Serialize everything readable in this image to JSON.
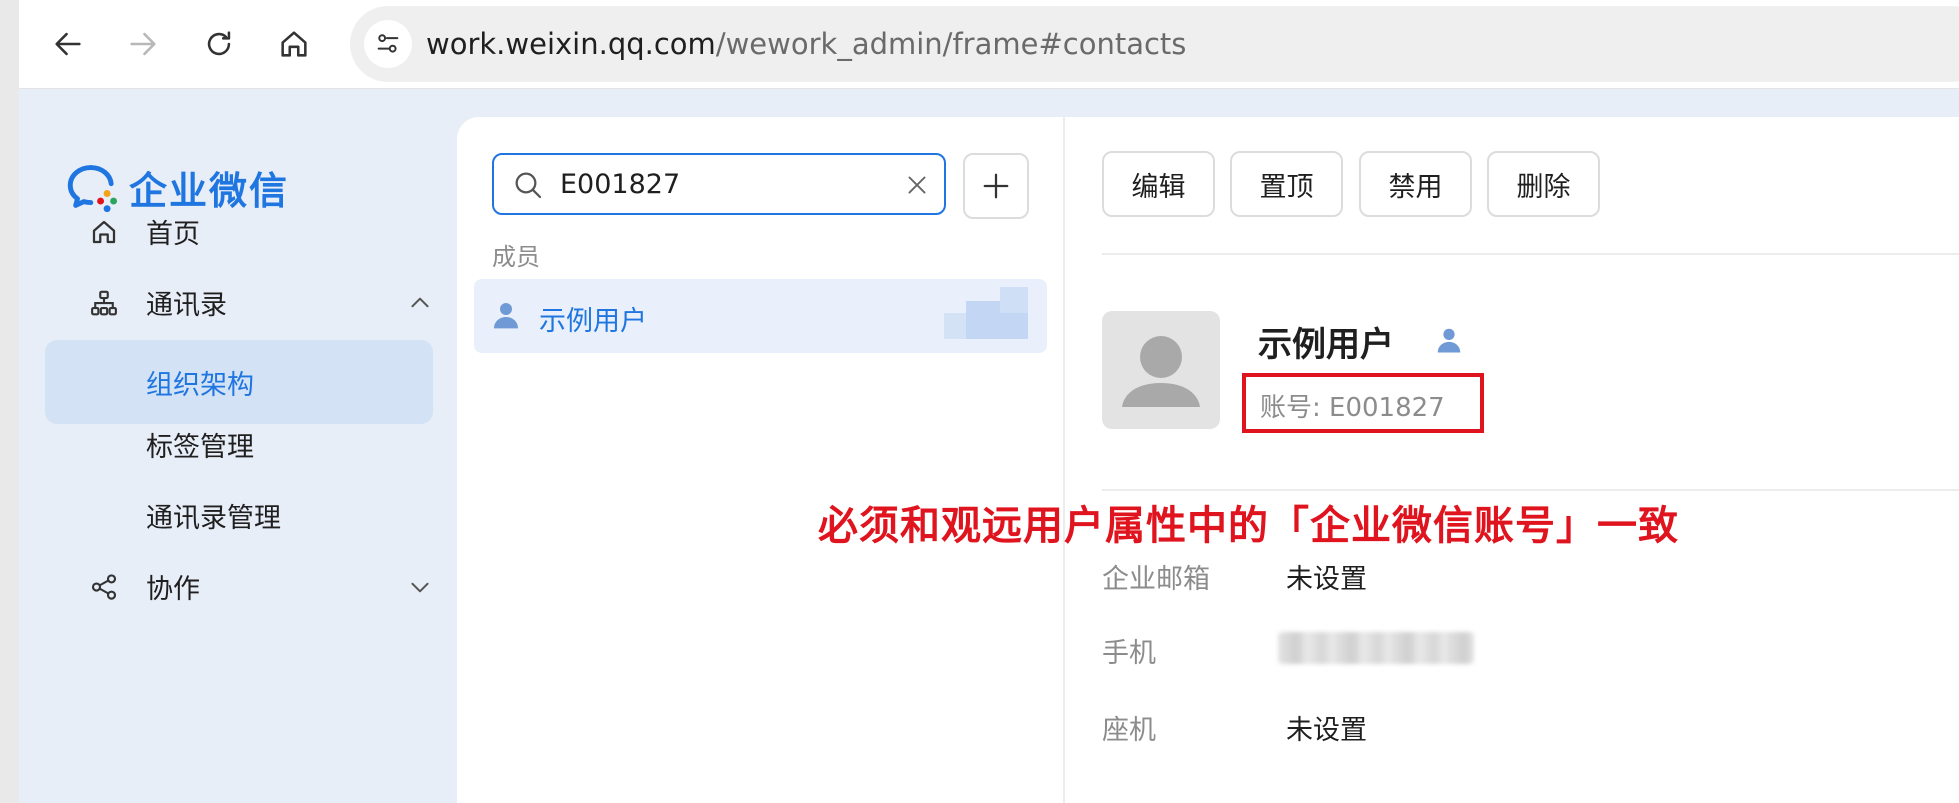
{
  "browser": {
    "url_host": "work.weixin.qq.com",
    "url_path": "/wework_admin/frame#contacts"
  },
  "brand": {
    "name": "企业微信",
    "color": "#1f76e0"
  },
  "sidebar": {
    "items": [
      {
        "label": "首页",
        "icon": "home-icon"
      },
      {
        "label": "通讯录",
        "icon": "org-chart-icon",
        "expanded": true
      },
      {
        "label": "组织架构",
        "active": true
      },
      {
        "label": "标签管理"
      },
      {
        "label": "通讯录管理"
      },
      {
        "label": "协作",
        "icon": "share-icon",
        "expanded": false
      }
    ]
  },
  "search": {
    "value": "E001827"
  },
  "results": {
    "section_label": "成员",
    "items": [
      {
        "label": "示例用户",
        "icon": "user-icon"
      }
    ]
  },
  "actions": [
    "编辑",
    "置顶",
    "禁用",
    "删除"
  ],
  "profile": {
    "name": "示例用户",
    "account_label": "账号:",
    "account_value": "E001827",
    "fields": [
      {
        "label": "企业邮箱",
        "value": "未设置"
      },
      {
        "label": "手机",
        "value": ""
      },
      {
        "label": "座机",
        "value": "未设置"
      }
    ]
  },
  "annotation": {
    "text": "必须和观远用户属性中的「企业微信账号」一致",
    "color": "#e0141e"
  }
}
